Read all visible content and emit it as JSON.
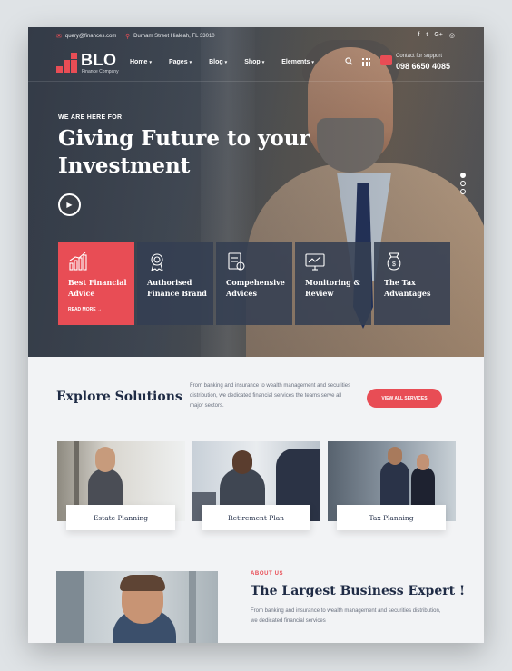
{
  "topbar": {
    "email": "query@finances.com",
    "address": "Durham Street Hialeah, FL 33010",
    "social_icons": [
      "facebook-icon",
      "twitter-icon",
      "google-plus-icon",
      "instagram-icon"
    ]
  },
  "brand": {
    "name": "BLO",
    "tagline": "Finance Company"
  },
  "nav": {
    "items": [
      {
        "label": "Home"
      },
      {
        "label": "Pages"
      },
      {
        "label": "Blog"
      },
      {
        "label": "Shop"
      },
      {
        "label": "Elements"
      }
    ]
  },
  "support": {
    "label": "Contact for support",
    "phone": "098 6650 4085"
  },
  "hero": {
    "eyebrow": "WE ARE HERE FOR",
    "headline": "Giving Future to your Investment",
    "slides_total": 3,
    "active_slide": 1
  },
  "service_cards": [
    {
      "title": "Best Financial Advice",
      "more": "READ MORE →",
      "icon": "bar-chart-icon",
      "active": true
    },
    {
      "title": "Authorised Finance Brand",
      "icon": "award-badge-icon",
      "active": false
    },
    {
      "title": "Compehensive Advices",
      "icon": "document-icon",
      "active": false
    },
    {
      "title": "Monitoring & Review",
      "icon": "monitor-chart-icon",
      "active": false
    },
    {
      "title": "The Tax Advantages",
      "icon": "money-bag-icon",
      "active": false
    }
  ],
  "solutions": {
    "title": "Explore Solutions",
    "description": "From banking and insurance to wealth management and securities distribution, we dedicated financial services the teams serve all major sectors.",
    "button": "VIEW ALL SERVICES",
    "tiles": [
      {
        "label": "Estate Planning"
      },
      {
        "label": "Retirement Plan"
      },
      {
        "label": "Tax Planning"
      }
    ]
  },
  "about": {
    "eyebrow": "ABOUT US",
    "title": "The Largest Business Expert !",
    "description": "From banking and insurance to wealth management and securities distribution, we dedicated financial services"
  },
  "colors": {
    "accent": "#e84d55",
    "navy": "#1f2b45",
    "card": "#343f52"
  }
}
